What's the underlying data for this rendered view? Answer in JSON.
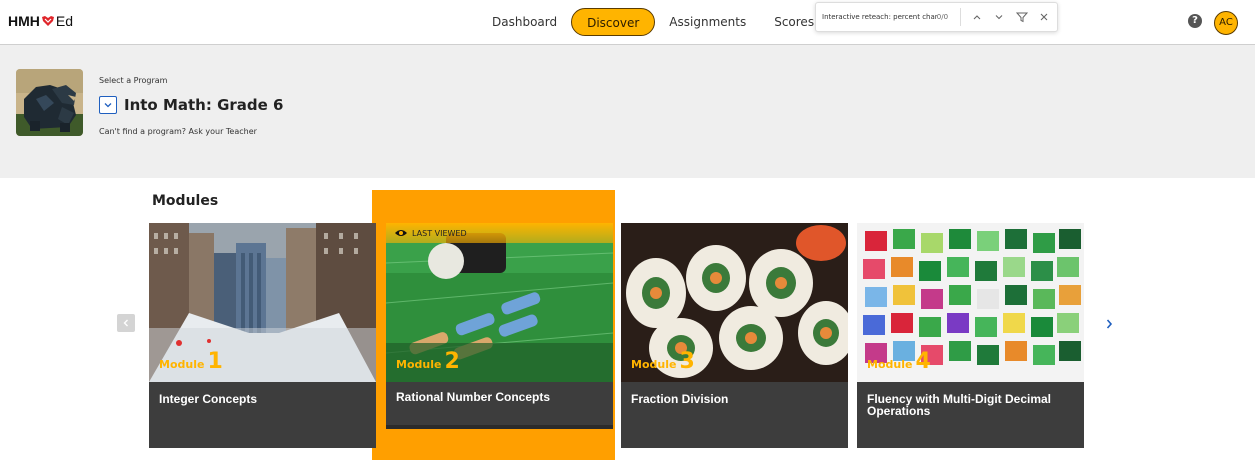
{
  "brand": {
    "left": "HMH",
    "right": "Ed",
    "heart_color": "#e0262b"
  },
  "nav": {
    "items": [
      {
        "label": "Dashboard",
        "active": false
      },
      {
        "label": "Discover",
        "active": true
      },
      {
        "label": "Assignments",
        "active": false
      },
      {
        "label": "Scores",
        "active": false
      }
    ]
  },
  "findbar": {
    "value": "Interactive reteach: percent char",
    "count": "0/0"
  },
  "user": {
    "help": "?",
    "initials": "AC"
  },
  "program": {
    "select_label": "Select a Program",
    "name": "Into Math: Grade 6",
    "cant_find": "Can't find a program? Ask your Teacher"
  },
  "modules": {
    "title": "Modules",
    "last_viewed_label": "LAST VIEWED",
    "module_word": "Module",
    "cards": [
      {
        "number": "1",
        "title": "Integer Concepts"
      },
      {
        "number": "2",
        "title": "Rational Number Concepts"
      },
      {
        "number": "3",
        "title": "Fraction Division"
      },
      {
        "number": "4",
        "title": "Fluency with Multi-Digit Decimal Operations"
      }
    ]
  },
  "colors": {
    "accent": "#ffb400",
    "highlight": "#ff9f00",
    "card_bg": "#3d3d3d",
    "link_blue": "#1f5fbf"
  }
}
